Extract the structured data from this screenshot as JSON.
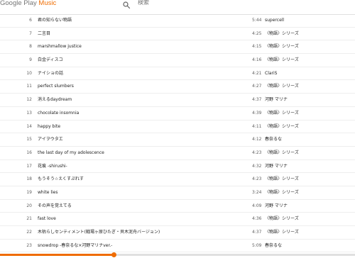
{
  "app": {
    "logo_prefix": "Google Play ",
    "logo_suffix": "Music",
    "accent_color": "#ef6c00"
  },
  "search": {
    "icon": "search-icon",
    "placeholder": "検索"
  },
  "tracks": [
    {
      "num": "6",
      "title": "君の知らない物語",
      "time": "5:44",
      "artist": "supercell"
    },
    {
      "num": "7",
      "title": "二言目",
      "time": "4:25",
      "artist": "〈物語〉シリーズ"
    },
    {
      "num": "8",
      "title": "marshmallow justice",
      "time": "4:15",
      "artist": "〈物語〉シリーズ"
    },
    {
      "num": "9",
      "title": "白金ディスコ",
      "time": "4:16",
      "artist": "〈物語〉シリーズ"
    },
    {
      "num": "10",
      "title": "ナイショの話",
      "time": "4:21",
      "artist": "ClariS"
    },
    {
      "num": "11",
      "title": "perfect slumbers",
      "time": "4:27",
      "artist": "〈物語〉シリーズ"
    },
    {
      "num": "12",
      "title": "消えるdaydream",
      "time": "4:37",
      "artist": "河野 マリナ"
    },
    {
      "num": "13",
      "title": "chocolate insomnia",
      "time": "4:39",
      "artist": "〈物語〉シリーズ"
    },
    {
      "num": "14",
      "title": "happy bite",
      "time": "4:11",
      "artist": "〈物語〉シリーズ"
    },
    {
      "num": "15",
      "title": "アイヲウタエ",
      "time": "4:12",
      "artist": "春奈るな"
    },
    {
      "num": "16",
      "title": "the last day of my adolescence",
      "time": "4:23",
      "artist": "〈物語〉シリーズ"
    },
    {
      "num": "17",
      "title": "花痕 -shirushi-",
      "time": "4:32",
      "artist": "河野 マリナ"
    },
    {
      "num": "18",
      "title": "もうそう☆えくすぷれす",
      "time": "4:23",
      "artist": "〈物語〉シリーズ"
    },
    {
      "num": "19",
      "title": "white lies",
      "time": "3:24",
      "artist": "〈物語〉シリーズ"
    },
    {
      "num": "20",
      "title": "その声を覚えてる",
      "time": "4:09",
      "artist": "河野 マリナ"
    },
    {
      "num": "21",
      "title": "fast love",
      "time": "4:36",
      "artist": "〈物語〉シリーズ"
    },
    {
      "num": "22",
      "title": "木枯らしセンティメント(戦場ヶ原ひたぎ・貝木泥舟バージョン)",
      "time": "4:37",
      "artist": "〈物語〉シリーズ"
    },
    {
      "num": "23",
      "title": "snowdrop -春奈るな×河野マリナver.-",
      "time": "5:09",
      "artist": "春奈るな"
    }
  ],
  "player": {
    "progress_fraction": 0.32
  }
}
